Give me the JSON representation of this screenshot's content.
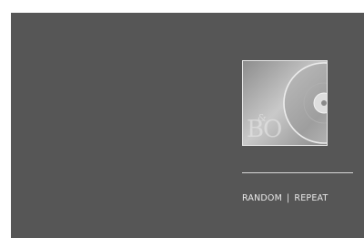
{
  "display": {
    "background_color": "#565656",
    "album_art": {
      "icon": "cd-disc-icon",
      "logo_text": "B&O"
    },
    "options": {
      "random_label": "RANDOM",
      "separator": "|",
      "repeat_label": "REPEAT"
    }
  }
}
